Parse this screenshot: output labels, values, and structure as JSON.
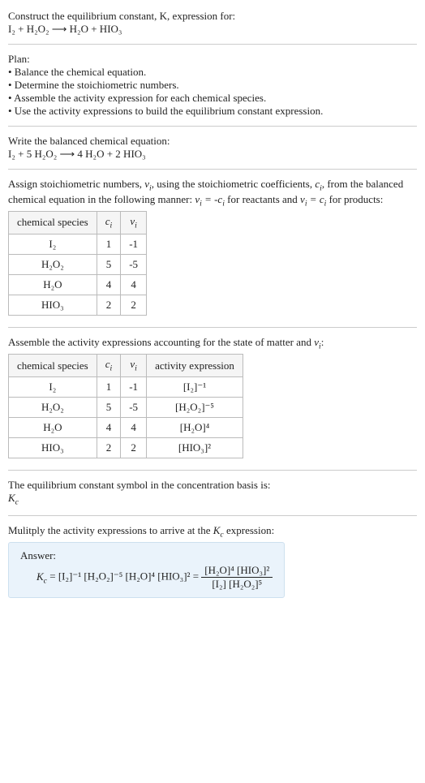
{
  "header": {
    "line1": "Construct the equilibrium constant, K, expression for:",
    "equation": "I₂ + H₂O₂ ⟶ H₂O + HIO₃"
  },
  "plan": {
    "title": "Plan:",
    "b1": "• Balance the chemical equation.",
    "b2": "• Determine the stoichiometric numbers.",
    "b3": "• Assemble the activity expression for each chemical species.",
    "b4": "• Use the activity expressions to build the equilibrium constant expression."
  },
  "balanced": {
    "title": "Write the balanced chemical equation:",
    "equation": "I₂ + 5 H₂O₂ ⟶ 4 H₂O + 2 HIO₃"
  },
  "stoich": {
    "intro_a": "Assign stoichiometric numbers, ",
    "intro_b": ", using the stoichiometric coefficients, ",
    "intro_c": ", from the balanced chemical equation in the following manner: ",
    "intro_d": " for reactants and ",
    "intro_e": " for products:",
    "table": {
      "h1": "chemical species",
      "h2": "cᵢ",
      "h3": "νᵢ",
      "rows": [
        {
          "sp": "I₂",
          "c": "1",
          "v": "-1"
        },
        {
          "sp": "H₂O₂",
          "c": "5",
          "v": "-5"
        },
        {
          "sp": "H₂O",
          "c": "4",
          "v": "4"
        },
        {
          "sp": "HIO₃",
          "c": "2",
          "v": "2"
        }
      ]
    }
  },
  "activity": {
    "intro_a": "Assemble the activity expressions accounting for the state of matter and ",
    "intro_b": ":",
    "table": {
      "h1": "chemical species",
      "h2": "cᵢ",
      "h3": "νᵢ",
      "h4": "activity expression",
      "rows": [
        {
          "sp": "I₂",
          "c": "1",
          "v": "-1",
          "expr": "[I₂]⁻¹"
        },
        {
          "sp": "H₂O₂",
          "c": "5",
          "v": "-5",
          "expr": "[H₂O₂]⁻⁵"
        },
        {
          "sp": "H₂O",
          "c": "4",
          "v": "4",
          "expr": "[H₂O]⁴"
        },
        {
          "sp": "HIO₃",
          "c": "2",
          "v": "2",
          "expr": "[HIO₃]²"
        }
      ]
    }
  },
  "symbol": {
    "line1": "The equilibrium constant symbol in the concentration basis is:",
    "line2": "K",
    "sub": "c"
  },
  "multiply": {
    "intro_a": "Mulitply the activity expressions to arrive at the ",
    "intro_b": " expression:"
  },
  "answer": {
    "label": "Answer:",
    "lhs_k": "K",
    "lhs_sub": "c",
    "eq1": " = [I₂]⁻¹ [H₂O₂]⁻⁵ [H₂O]⁴ [HIO₃]² = ",
    "num": "[H₂O]⁴ [HIO₃]²",
    "den": "[I₂] [H₂O₂]⁵"
  }
}
